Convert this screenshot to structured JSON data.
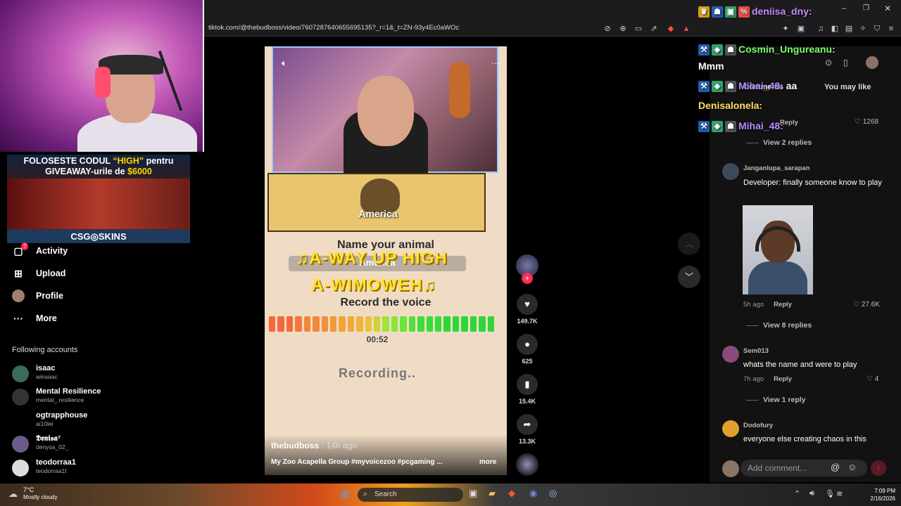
{
  "browser": {
    "url": "tiktok.com/@thebudboss/video/7607287640655695135?_r=1&_t=ZN-93y4Ec0aWOc"
  },
  "stream_overlay": {
    "promo_line1_pre": "FOLOSESTE CODUL ",
    "promo_line1_code": "“HIGH”",
    "promo_line1_post": " pentru",
    "promo_line2_pre": "GIVEAWAY-urile de ",
    "promo_line2_amount": "$6000",
    "promo_brand": "CSG◎SKINS",
    "chat": [
      {
        "user": "deniisa_dny:",
        "text": "",
        "color": "#c98aff"
      },
      {
        "user": "Cosmin_Ungureanu:",
        "text": "",
        "color": "#7dff6b"
      },
      {
        "user": "",
        "text": "Mmm",
        "color": "#ffffff"
      },
      {
        "user": "Mihai_48:",
        "text": "aa",
        "color": "#b48cff"
      },
      {
        "user": "Denisalonela:",
        "text": "",
        "color": "#ffe066"
      },
      {
        "user": "Mihai_48:",
        "text": "",
        "color": "#b48cff"
      }
    ]
  },
  "sidebar": {
    "activity_badge": "7",
    "items": [
      {
        "label": "Activity",
        "icon": "activity-icon"
      },
      {
        "label": "Upload",
        "icon": "upload-icon"
      },
      {
        "label": "Profile",
        "icon": "profile-icon"
      },
      {
        "label": "More",
        "icon": "more-icon"
      }
    ],
    "following_title": "Following accounts",
    "accounts": [
      {
        "name": "isaac",
        "handle": "winsaac",
        "color": "#3b6b5a"
      },
      {
        "name": "Mental Resilience",
        "handle": "mental_.resilience",
        "color": "#333333"
      },
      {
        "name": "ogtrapphouse",
        "handle": "ai10lei",
        "color": "#000000"
      },
      {
        "name": "𝕯𝖊𝖓𝖎𝖘𝖆⁷",
        "handle": "denysa_02_",
        "color": "#6b5a8a"
      },
      {
        "name": "teodorraa1",
        "handle": "teodorraa1t",
        "color": "#dddddd"
      }
    ]
  },
  "video": {
    "animal_label": "America",
    "prompt_title": "Name your animal",
    "answer": "America",
    "lyric_line1": "♫A-WAY UP HIGH",
    "lyric_line2": "A-WIMOWEH♫",
    "record_title": "Record the voice",
    "timer": "00:52",
    "status": "Recording..",
    "author": "thebudboss",
    "posted": " · 14h ago",
    "caption": "My Zoo Acapella Group #myvoicezoo #pcgaming ...",
    "more_label": "more",
    "meter_colors": [
      "#f26a3c",
      "#f26a3c",
      "#f26a3c",
      "#f27a3c",
      "#f2873c",
      "#f2873c",
      "#f28f3c",
      "#f2993c",
      "#f2a33c",
      "#f2a83c",
      "#f2b33c",
      "#e7c23c",
      "#c8d43a",
      "#a6e03a",
      "#86e63a",
      "#6fe43a",
      "#52e03a",
      "#3ede3a",
      "#33dd3a",
      "#33dd3a",
      "#2fd63a",
      "#2fd63a",
      "#2fd63a",
      "#2fd63a",
      "#2fd63a",
      "#2fd63a"
    ]
  },
  "actions": {
    "likes": "149.7K",
    "comments": "625",
    "saves": "15.4K",
    "shares": "13.3K"
  },
  "comments_panel": {
    "tab_comments": "Comments",
    "tab_you_may_like": "You may like",
    "first_like": "1268",
    "first_reply_label": "Reply",
    "view_replies_1": "View 2 replies",
    "comments": [
      {
        "user": "Janganlupa_sarapan",
        "text": "Developer: finally someone know to play",
        "time": "5h ago",
        "reply": "Reply",
        "likes": "27.6K",
        "view_replies": "View 8 replies",
        "color": "#3d4a5a"
      },
      {
        "user": "Sem013",
        "text": "whats the name and were to play",
        "time": "7h ago",
        "reply": "Reply",
        "likes": "4",
        "view_replies": "View 1 reply",
        "color": "#8a4a7a"
      },
      {
        "user": "Dodofury",
        "text": "everyone else creating chaos in this",
        "time": "",
        "reply": "",
        "likes": "",
        "view_replies": "",
        "color": "#e0a030"
      }
    ],
    "add_comment_placeholder": "Add comment..."
  },
  "taskbar": {
    "weather_temp": "7°C",
    "weather_desc": "Mostly cloudy",
    "search_label": "Search",
    "time": "7:09 PM",
    "date": "2/16/2026"
  }
}
